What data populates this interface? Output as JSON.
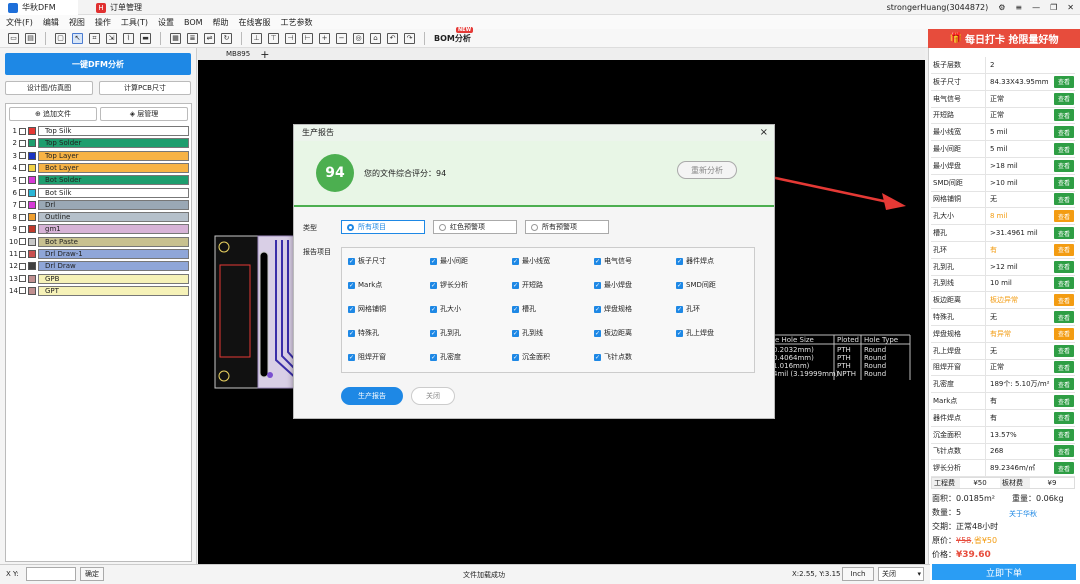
{
  "titlebar": {
    "app_tab": "华秋DFM",
    "order_tab": "订单管理",
    "user": "strongerHuang(3044872)"
  },
  "menu": [
    "文件(F)",
    "编辑",
    "视图",
    "操作",
    "工具(T)",
    "设置",
    "BOM",
    "帮助",
    "在线客服",
    "工艺参数"
  ],
  "toolbar": {
    "bom_label": "BOM分析",
    "bom_badge": "NEW"
  },
  "left": {
    "dfm_button": "一键DFM分析",
    "design_button": "设计图/仿真图",
    "calc_button": "计算PCB尺寸",
    "add_file": "追加文件",
    "layer_mgr": "层管理",
    "layers": [
      {
        "n": "1",
        "name": "Top Silk",
        "swatch": "#e53935",
        "bg": "#ffffff"
      },
      {
        "n": "2",
        "name": "Top Solder",
        "swatch": "#1e9e6e",
        "bg": "#1e9e6e"
      },
      {
        "n": "3",
        "name": "Top Layer",
        "swatch": "#1a34c4",
        "bg": "#f7b345"
      },
      {
        "n": "4",
        "name": "Bot Layer",
        "swatch": "#f2d245",
        "bg": "#f7b345"
      },
      {
        "n": "5",
        "name": "Bot Solder",
        "swatch": "#d63ad6",
        "bg": "#1e9e6e"
      },
      {
        "n": "6",
        "name": "Bot Silk",
        "swatch": "#2ab6d6",
        "bg": "#ffffff"
      },
      {
        "n": "7",
        "name": "Drl",
        "swatch": "#d63ad6",
        "bg": "#9aa8b5"
      },
      {
        "n": "8",
        "name": "Outline",
        "swatch": "#f0a030",
        "bg": "#b5c0ca"
      },
      {
        "n": "9",
        "name": "gm1",
        "swatch": "#c0392b",
        "bg": "#d7b3d7"
      },
      {
        "n": "10",
        "name": "Bot Paste",
        "swatch": "#c8c8c8",
        "bg": "#c8c190"
      },
      {
        "n": "11",
        "name": "Drl Draw-1",
        "swatch": "#c85050",
        "bg": "#8fa6d8"
      },
      {
        "n": "12",
        "name": "Drl Draw",
        "swatch": "#404040",
        "bg": "#8fa6d8"
      },
      {
        "n": "13",
        "name": "GPB",
        "swatch": "#c09090",
        "bg": "#f6f2b8"
      },
      {
        "n": "14",
        "name": "GPT",
        "swatch": "#c09090",
        "bg": "#f6f2b8"
      }
    ]
  },
  "canvas": {
    "tab": "MB895",
    "drill_table": {
      "headers": [
        "le Hole Size",
        "Ploted",
        "Hole Type"
      ],
      "rows": [
        [
          "0.2032mm)",
          "PTH",
          "Round"
        ],
        [
          "0.4064mm)",
          "PTH",
          "Round"
        ],
        [
          "1.016mm)",
          "PTH",
          "Round"
        ],
        [
          "4mil (3.19999mm)",
          "NPTH",
          "Round"
        ]
      ]
    }
  },
  "dialog": {
    "title": "生产报告",
    "score": "94",
    "score_text": "您的文件综合评分：94",
    "reanalyze": "重新分析",
    "type_label": "类型",
    "radios": [
      "所有项目",
      "红色预警项",
      "所有预警项"
    ],
    "items_label": "报告项目",
    "items": [
      "板子尺寸",
      "最小间距",
      "最小线宽",
      "电气信号",
      "器件焊点",
      "Mark点",
      "锣长分析",
      "开短路",
      "最小焊盘",
      "SMD间距",
      "网格铺铜",
      "孔大小",
      "槽孔",
      "焊盘规格",
      "孔环",
      "特殊孔",
      "孔到孔",
      "孔到线",
      "板边距离",
      "孔上焊盘",
      "阻焊开窗",
      "孔密度",
      "沉金面积",
      "飞针点数"
    ],
    "generate": "生产报告",
    "close": "关闭"
  },
  "right": {
    "ad": "每日打卡 抢限量好物",
    "view": "查看",
    "rows": [
      {
        "k": "板子层数",
        "v": "2",
        "btn": ""
      },
      {
        "k": "板子尺寸",
        "v": "84.33X43.95mm",
        "btn": "ok"
      },
      {
        "k": "电气信号",
        "v": "正常",
        "btn": "ok"
      },
      {
        "k": "开短路",
        "v": "正常",
        "btn": "ok"
      },
      {
        "k": "最小线宽",
        "v": "5 mil",
        "btn": "ok"
      },
      {
        "k": "最小间距",
        "v": "5 mil",
        "btn": "ok"
      },
      {
        "k": "最小焊盘",
        "v": ">18 mil",
        "btn": "ok"
      },
      {
        "k": "SMD间距",
        "v": ">10 mil",
        "btn": "ok"
      },
      {
        "k": "网格铺铜",
        "v": "无",
        "btn": "ok"
      },
      {
        "k": "孔大小",
        "v": "8 mil",
        "btn": "warn"
      },
      {
        "k": "槽孔",
        "v": ">31.4961 mil",
        "btn": "ok"
      },
      {
        "k": "孔环",
        "v": "有",
        "btn": "warn"
      },
      {
        "k": "孔到孔",
        "v": ">12 mil",
        "btn": "ok"
      },
      {
        "k": "孔到线",
        "v": "10 mil",
        "btn": "ok"
      },
      {
        "k": "板边距离",
        "v": "板边异常",
        "btn": "warn"
      },
      {
        "k": "特殊孔",
        "v": "无",
        "btn": "ok"
      },
      {
        "k": "焊盘规格",
        "v": "有异常",
        "btn": "warn"
      },
      {
        "k": "孔上焊盘",
        "v": "无",
        "btn": "ok"
      },
      {
        "k": "阻焊开窗",
        "v": "正常",
        "btn": "ok"
      },
      {
        "k": "孔密度",
        "v": "189个: 5.10万/m²",
        "btn": "ok"
      },
      {
        "k": "Mark点",
        "v": "有",
        "btn": "ok"
      },
      {
        "k": "器件焊点",
        "v": "有",
        "btn": "ok"
      },
      {
        "k": "沉金面积",
        "v": "13.57%",
        "btn": "ok"
      },
      {
        "k": "飞针点数",
        "v": "268",
        "btn": "ok"
      },
      {
        "k": "锣长分析",
        "v": "89.2346m/㎡",
        "btn": "ok"
      }
    ],
    "fee1_label": "工程费",
    "fee1": "¥50",
    "fee2_label": "板材费",
    "fee2": "¥9",
    "area": "面积：0.0185m²",
    "weight": "重量：0.06kg",
    "qty": "数量：5",
    "about": "关于华秋",
    "lead": "交期：正常48小时",
    "orig_label": "原价：",
    "orig_price": "¥58",
    "save": ",省¥50",
    "price_label": "价格：",
    "price": "¥39.60",
    "order": "立即下单"
  },
  "status": {
    "xy_label": "X Y:",
    "confirm": "确定",
    "msg": "文件加载成功",
    "coords": "X:2.55, Y:3.15",
    "unit": "Inch",
    "mode": "关闭"
  },
  "colors": {
    "accent": "#1e88e5",
    "ok": "#2e9e44",
    "warn": "#f39c12",
    "score": "#4caf50"
  }
}
